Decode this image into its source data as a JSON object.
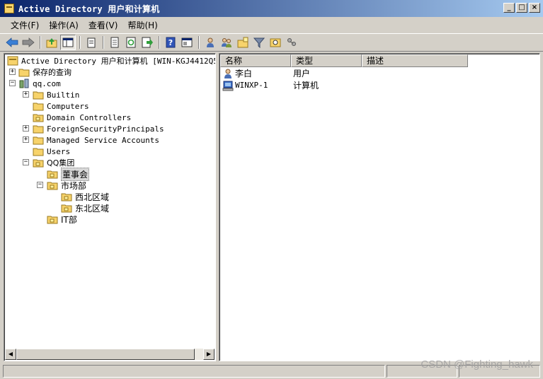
{
  "window": {
    "title": "Active Directory 用户和计算机",
    "controls": {
      "minimize": "_",
      "maximize": "□",
      "close": "×"
    }
  },
  "menu": [
    {
      "label": "文件(F)"
    },
    {
      "label": "操作(A)"
    },
    {
      "label": "查看(V)"
    },
    {
      "label": "帮助(H)"
    }
  ],
  "toolbar": {
    "buttons": [
      "back-icon",
      "forward-icon",
      "up-folder-icon",
      "console-tree-icon",
      "copy-icon",
      "properties-icon",
      "refresh-icon",
      "export-icon",
      "help-icon",
      "console-icon",
      "new-user-icon",
      "new-group-icon",
      "new-ou-icon",
      "filter-icon",
      "find-icon",
      "delegate-icon"
    ]
  },
  "tree": {
    "root": "Active Directory 用户和计算机 [WIN-KGJ4412Q5V...",
    "saved_queries": "保存的查询",
    "domain": "qq.com",
    "builtin": "Builtin",
    "computers": "Computers",
    "domain_controllers": "Domain Controllers",
    "foreign": "ForeignSecurityPrincipals",
    "managed": "Managed Service Accounts",
    "users": "Users",
    "qq_group": "QQ集团",
    "board": "董事会",
    "market": "市场部",
    "northwest": "西北区域",
    "northeast": "东北区域",
    "it": "IT部"
  },
  "list": {
    "columns": {
      "name": "名称",
      "type": "类型",
      "desc": "描述"
    },
    "rows": [
      {
        "name": "李白",
        "type": "用户",
        "icon": "user-icon"
      },
      {
        "name": "WINXP-1",
        "type": "计算机",
        "icon": "computer-icon"
      }
    ]
  },
  "watermark": "CSDN @Fighting_hawk"
}
